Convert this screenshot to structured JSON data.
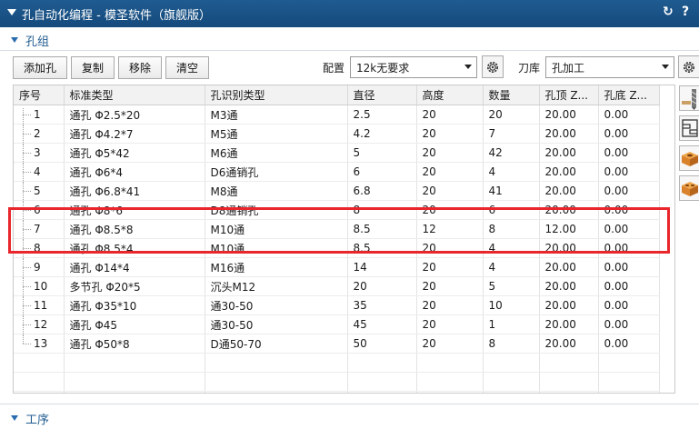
{
  "titlebar": {
    "title": "孔自动化编程 - 模圣软件（旗舰版）",
    "reset_icon": "↻",
    "help_icon": "?"
  },
  "hole_group": {
    "section_label": "孔组",
    "buttons": {
      "add": "添加孔",
      "copy": "复制",
      "remove": "移除",
      "clear": "清空"
    },
    "config_label": "配置",
    "config_value": "12k无要求",
    "tool_lib_label": "刀库",
    "tool_lib_value": "孔加工"
  },
  "table": {
    "columns": [
      "序号",
      "标准类型",
      "孔识别类型",
      "直径",
      "高度",
      "数量",
      "孔顶 Z...",
      "孔底 Z..."
    ],
    "rows": [
      [
        "1",
        "通孔 Φ2.5*20",
        "M3通",
        "2.5",
        "20",
        "20",
        "20.00",
        "0.00"
      ],
      [
        "2",
        "通孔 Φ4.2*7",
        "M5通",
        "4.2",
        "20",
        "7",
        "20.00",
        "0.00"
      ],
      [
        "3",
        "通孔 Φ5*42",
        "M6通",
        "5",
        "20",
        "42",
        "20.00",
        "0.00"
      ],
      [
        "4",
        "通孔 Φ6*4",
        "D6通销孔",
        "6",
        "20",
        "4",
        "20.00",
        "0.00"
      ],
      [
        "5",
        "通孔 Φ6.8*41",
        "M8通",
        "6.8",
        "20",
        "41",
        "20.00",
        "0.00"
      ],
      [
        "6",
        "通孔 Φ8*6",
        "D8通销孔",
        "8",
        "20",
        "6",
        "20.00",
        "0.00"
      ],
      [
        "7",
        "通孔 Φ8.5*8",
        "M10通",
        "8.5",
        "12",
        "8",
        "12.00",
        "0.00"
      ],
      [
        "8",
        "通孔 Φ8.5*4",
        "M10通",
        "8.5",
        "20",
        "4",
        "20.00",
        "0.00"
      ],
      [
        "9",
        "通孔 Φ14*4",
        "M16通",
        "14",
        "20",
        "4",
        "20.00",
        "0.00"
      ],
      [
        "10",
        "多节孔 Φ20*5",
        "沉头M12",
        "20",
        "20",
        "5",
        "20.00",
        "0.00"
      ],
      [
        "11",
        "通孔 Φ35*10",
        "通30-50",
        "35",
        "20",
        "10",
        "20.00",
        "0.00"
      ],
      [
        "12",
        "通孔 Φ45",
        "通30-50",
        "45",
        "20",
        "1",
        "20.00",
        "0.00"
      ],
      [
        "13",
        "通孔 Φ50*8",
        "D通50-70",
        "50",
        "20",
        "8",
        "20.00",
        "0.00"
      ]
    ],
    "empty_rows": 3
  },
  "process": {
    "section_label": "工序"
  },
  "colors": {
    "titlebar": "#1a5286",
    "highlight": "#e8262b",
    "section": "#1f5b90"
  },
  "icons": {
    "side_tools": [
      "drill-tool-icon",
      "hole-pattern-icon",
      "block-hole-icon",
      "block-pocket-icon"
    ]
  }
}
